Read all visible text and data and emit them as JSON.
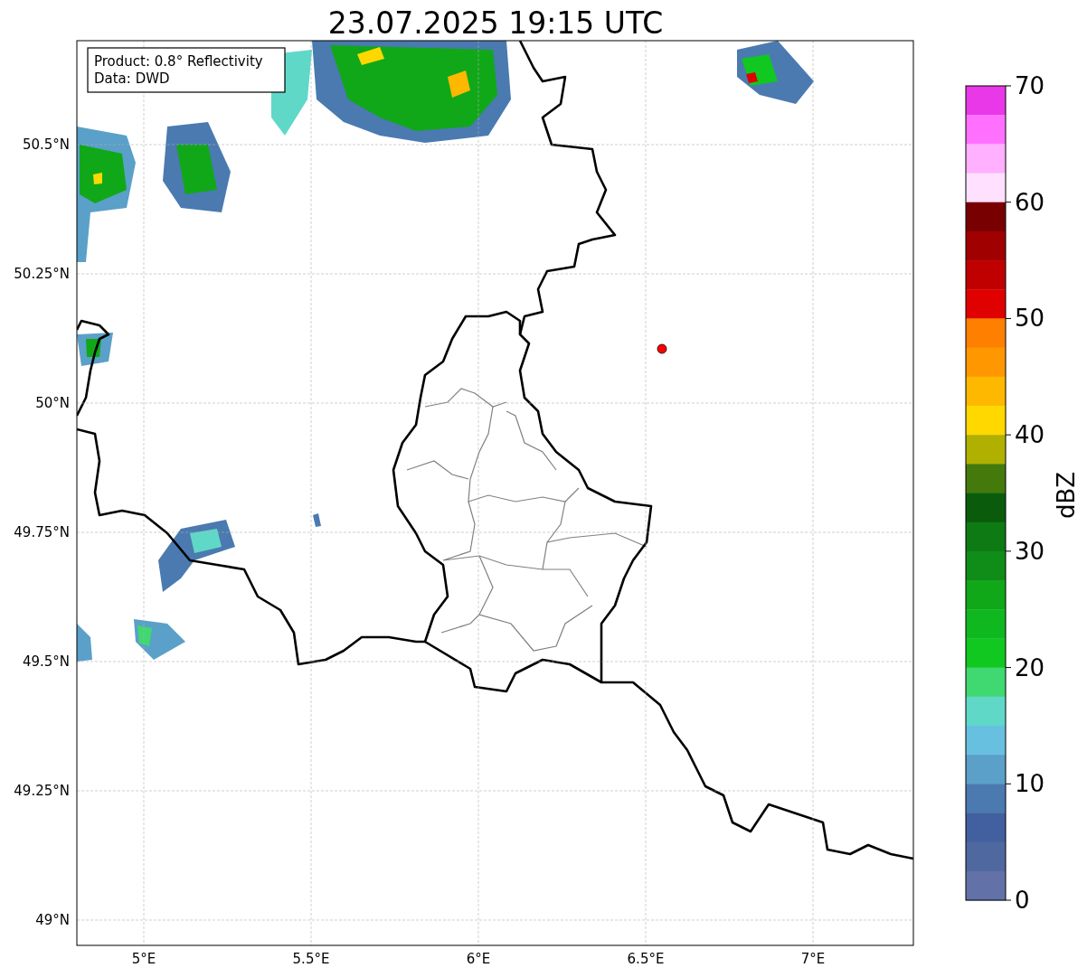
{
  "title": "23.07.2025 19:15 UTC",
  "info_box": [
    "Product: 0.8° Reflectivity",
    "Data: DWD"
  ],
  "map": {
    "lat_ticks": [
      "50.5°N",
      "50.25°N",
      "50°N",
      "49.75°N",
      "49.5°N",
      "49.25°N",
      "49°N"
    ],
    "lon_ticks": [
      "5°E",
      "5.5°E",
      "6°E",
      "6.5°E",
      "7°E"
    ],
    "marker": {
      "color": "#ff0000"
    }
  },
  "colorbar": {
    "label": "dBZ",
    "ticks": [
      "70",
      "60",
      "50",
      "40",
      "30",
      "20",
      "10",
      "0"
    ],
    "bins": [
      {
        "color": "#e838e8"
      },
      {
        "color": "#ff70ff"
      },
      {
        "color": "#ffb0ff"
      },
      {
        "color": "#ffe0ff"
      },
      {
        "color": "#780000"
      },
      {
        "color": "#a00000"
      },
      {
        "color": "#c00000"
      },
      {
        "color": "#e00000"
      },
      {
        "color": "#ff8000"
      },
      {
        "color": "#ff9800"
      },
      {
        "color": "#ffb800"
      },
      {
        "color": "#ffd800"
      },
      {
        "color": "#b0b000"
      },
      {
        "color": "#447a0c"
      },
      {
        "color": "#0a5c0c"
      },
      {
        "color": "#0e7a14"
      },
      {
        "color": "#108c18"
      },
      {
        "color": "#10a818"
      },
      {
        "color": "#10b820"
      },
      {
        "color": "#10c820"
      },
      {
        "color": "#40d870"
      },
      {
        "color": "#60d8c8"
      },
      {
        "color": "#68c0e0"
      },
      {
        "color": "#5aa0c8"
      },
      {
        "color": "#4a7ab0"
      },
      {
        "color": "#4260a0"
      },
      {
        "color": "#5068a0"
      },
      {
        "color": "#6272a8"
      }
    ]
  }
}
